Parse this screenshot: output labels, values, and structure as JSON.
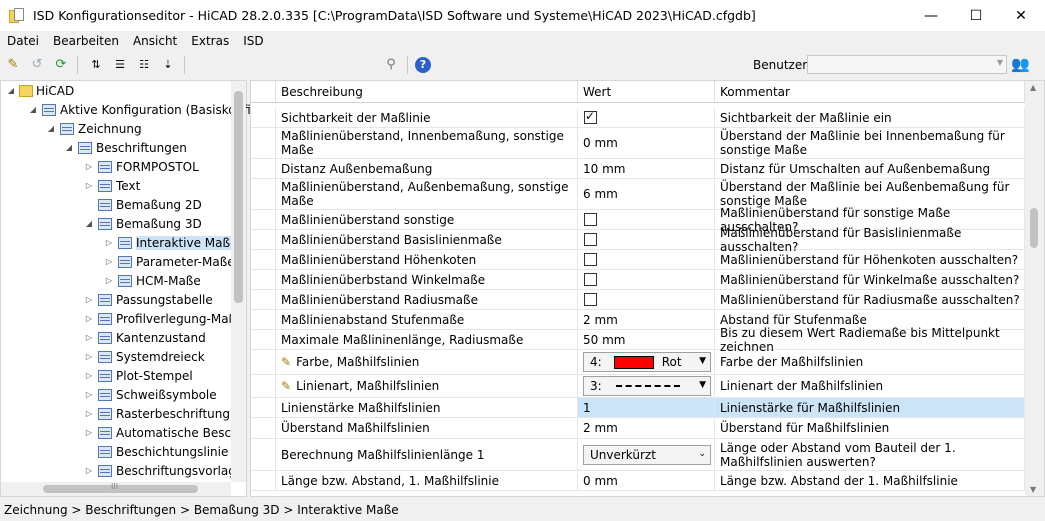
{
  "window": {
    "title": "ISD Konfigurationseditor  -  HiCAD 28.2.0.335 [C:\\ProgramData\\ISD Software und Systeme\\HiCAD 2023\\HiCAD.cfgdb]",
    "minimize": "—",
    "maximize": "☐",
    "close": "✕"
  },
  "menu": [
    "Datei",
    "Bearbeiten",
    "Ansicht",
    "Extras",
    "ISD"
  ],
  "toolbar": {
    "user_label": "Benutzer",
    "user_value": ""
  },
  "tree": {
    "items": [
      {
        "label": "HiCAD",
        "expander": "◢"
      },
      {
        "label": "Aktive Konfiguration (Basiskonfi",
        "expander": "◢"
      },
      {
        "label": "Zeichnung",
        "expander": "◢"
      },
      {
        "label": "Beschriftungen",
        "expander": "◢"
      },
      {
        "label": "FORMPOSTOL",
        "expander": "▷"
      },
      {
        "label": "Text",
        "expander": "▷"
      },
      {
        "label": "Bemaßung 2D",
        "expander": ""
      },
      {
        "label": "Bemaßung 3D",
        "expander": "◢"
      },
      {
        "label": "Interaktive Maße",
        "expander": "▷"
      },
      {
        "label": "Parameter-Maße",
        "expander": "▷"
      },
      {
        "label": "HCM-Maße",
        "expander": "▷"
      },
      {
        "label": "Passungstabelle",
        "expander": "▷"
      },
      {
        "label": "Profilverlegung-Maße",
        "expander": "▷"
      },
      {
        "label": "Kantenzustand",
        "expander": "▷"
      },
      {
        "label": "Systemdreieck",
        "expander": "▷"
      },
      {
        "label": "Plot-Stempel",
        "expander": "▷"
      },
      {
        "label": "Schweißsymbole",
        "expander": "▷"
      },
      {
        "label": "Rasterbeschriftung",
        "expander": "▷"
      },
      {
        "label": "Automatische Beschr",
        "expander": "▷"
      },
      {
        "label": "Beschichtungslinie in",
        "expander": ""
      },
      {
        "label": "Beschriftungsvorlage",
        "expander": "▷"
      }
    ],
    "hscroll_arrow": "III"
  },
  "grid": {
    "headers": [
      "Beschreibung",
      "Wert",
      "Kommentar"
    ],
    "rows": [
      {
        "desc": "Sichtbarkeit der Maßlinie",
        "value": "",
        "checkbox": true,
        "checked": true,
        "comment": "Sichtbarkeit der Maßlinie ein"
      },
      {
        "desc": "Maßlinienüberstand, Innenbemaßung, sonstige Maße",
        "value": "0 mm",
        "comment": "Überstand der Maßlinie bei Innenbemaßung für sonstige Maße"
      },
      {
        "desc": "Distanz Außenbemaßung",
        "value": "10 mm",
        "comment": "Distanz für Umschalten auf Außenbemaßung"
      },
      {
        "desc": "Maßlinienüberstand, Außenbemaßung, sonstige Maße",
        "value": "6 mm",
        "comment": "Überstand der Maßlinie bei Außenbemaßung für sonstige Maße"
      },
      {
        "desc": "Maßlinienüberstand sonstige",
        "value": "",
        "checkbox": true,
        "checked": false,
        "comment": "Maßlinienüberstand für sonstige Maße ausschalten?"
      },
      {
        "desc": "Maßlinienüberstand Basislinienmaße",
        "value": "",
        "checkbox": true,
        "checked": false,
        "comment": "Maßlinienüberstand für Basislinienmaße ausschalten?"
      },
      {
        "desc": "Maßlinienüberstand Höhenkoten",
        "value": "",
        "checkbox": true,
        "checked": false,
        "comment": "Maßlinienüberstand für Höhenkoten ausschalten?"
      },
      {
        "desc": "Maßlinienüberbstand Winkelmaße",
        "value": "",
        "checkbox": true,
        "checked": false,
        "comment": "Maßlinienüberstand für Winkelmaße ausschalten?"
      },
      {
        "desc": "Maßlinienüberstand Radiusmaße",
        "value": "",
        "checkbox": true,
        "checked": false,
        "comment": "Maßlinienüberstand für Radiusmaße ausschalten?"
      },
      {
        "desc": "Maßlinienabstand Stufenmaße",
        "value": "2 mm",
        "comment": "Abstand für Stufenmaße"
      },
      {
        "desc": "Maximale Maßlininenlänge, Radiusmaße",
        "value": "50 mm",
        "comment": "Bis zu diesem Wert Radiemaße bis Mittelpunkt zeichnen"
      },
      {
        "desc": "Farbe, Maßhilfslinien",
        "pencil": true,
        "combo": "color",
        "combo_index": "4:",
        "combo_text": "Rot",
        "color": "#ff0000",
        "comment": "Farbe der Maßhilfslinien"
      },
      {
        "desc": "Linienart, Maßhilfslinien",
        "pencil": true,
        "combo": "line",
        "combo_index": "3:",
        "combo_text": "",
        "comment": "Linienart der Maßhilfslinien"
      },
      {
        "desc": "Linienstärke Maßhilfslinien",
        "value": "1",
        "selected": true,
        "comment": "Linienstärke für Maßhilfslinien"
      },
      {
        "desc": "Überstand Maßhilfslinien",
        "value": "2 mm",
        "comment": "Überstand für Maßhilfslinien"
      },
      {
        "desc": "Berechnung Maßhilfslinienlänge 1",
        "combo": "text",
        "combo_text": "Unverkürzt",
        "comment": "Länge oder Abstand vom Bauteil der 1. Maßhilfslinien auswerten?"
      },
      {
        "desc": "Länge bzw. Abstand, 1. Maßhilfslinie",
        "value": "0 mm",
        "comment": "Länge bzw. Abstand der 1. Maßhilfslinie"
      }
    ]
  },
  "statusbar": {
    "breadcrumb": "Zeichnung > Beschriftungen > Bemaßung 3D > Interaktive Maße"
  }
}
